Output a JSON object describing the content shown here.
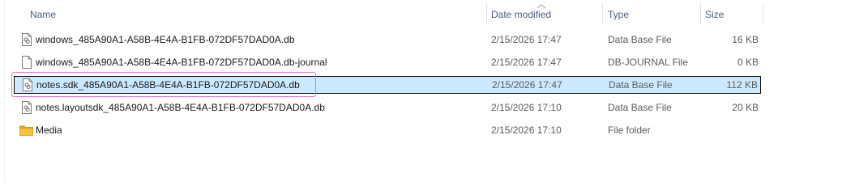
{
  "columns": {
    "name": "Name",
    "date_modified": "Date modified",
    "type": "Type",
    "size": "Size"
  },
  "sort": {
    "column": "date_modified",
    "indicator": "chevron-up-icon"
  },
  "files": [
    {
      "name": "windows_485A90A1-A58B-4E4A-B1FB-072DF57DAD0A.db",
      "date": "2/15/2026 17:47",
      "type": "Data Base File",
      "size": "16 KB",
      "icon": "db-file-icon",
      "selected": false
    },
    {
      "name": "windows_485A90A1-A58B-4E4A-B1FB-072DF57DAD0A.db-journal",
      "date": "2/15/2026 17:47",
      "type": "DB-JOURNAL File",
      "size": "0 KB",
      "icon": "blank-file-icon",
      "selected": false
    },
    {
      "name": "notes.sdk_485A90A1-A58B-4E4A-B1FB-072DF57DAD0A.db",
      "date": "2/15/2026 17:47",
      "type": "Data Base File",
      "size": "112 KB",
      "icon": "db-file-icon",
      "selected": true
    },
    {
      "name": "notes.layoutsdk_485A90A1-A58B-4E4A-B1FB-072DF57DAD0A.db",
      "date": "2/15/2026 17:10",
      "type": "Data Base File",
      "size": "20 KB",
      "icon": "db-file-icon",
      "selected": false
    },
    {
      "name": "Media",
      "date": "2/15/2026 17:10",
      "type": "File folder",
      "size": "",
      "icon": "folder-icon",
      "selected": false
    }
  ],
  "colors": {
    "selection": "#cce8ff",
    "highlight_outline": "#e878c8",
    "header_text": "#4c607a",
    "folder": "#f5c33b"
  }
}
